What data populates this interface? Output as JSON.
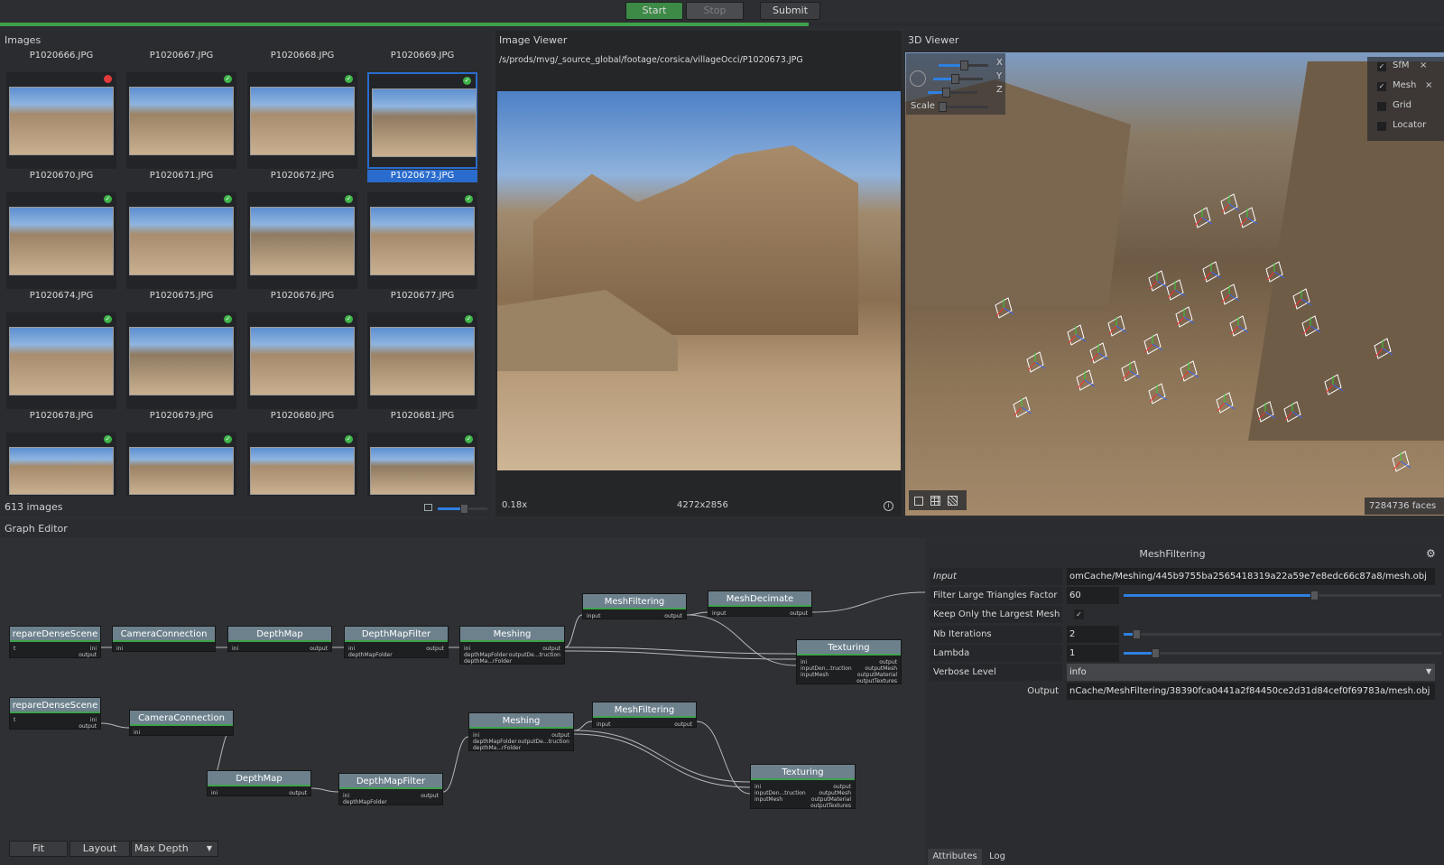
{
  "toolbar": {
    "start": "Start",
    "stop": "Stop",
    "submit": "Submit",
    "progress": 0.56
  },
  "images_panel": {
    "title": "Images",
    "count": "613 images",
    "zoom": 0.6,
    "header_labels": [
      "P1020666.JPG",
      "P1020667.JPG",
      "P1020668.JPG",
      "P1020669.JPG"
    ],
    "rows": [
      [
        "P1020670.JPG",
        "P1020671.JPG",
        "P1020672.JPG",
        "P1020673.JPG"
      ],
      [
        "P1020674.JPG",
        "P1020675.JPG",
        "P1020676.JPG",
        "P1020677.JPG"
      ],
      [
        "P1020678.JPG",
        "P1020679.JPG",
        "P1020680.JPG",
        "P1020681.JPG"
      ]
    ],
    "selected": "P1020673.JPG"
  },
  "image_viewer": {
    "title": "Image Viewer",
    "path": "/s/prods/mvg/_source_global/footage/corsica/villageOcci/P1020673.JPG",
    "zoom": "0.18x",
    "resolution": "4272x2856"
  },
  "viewer3d": {
    "title": "3D Viewer",
    "axes": [
      "X",
      "Y",
      "Z"
    ],
    "scale_label": "Scale",
    "layers": [
      "SfM",
      "Mesh",
      "Grid",
      "Locator"
    ],
    "layer_checked": [
      true,
      true,
      false,
      false
    ],
    "faces": "7284736 faces",
    "close_glyph": "×"
  },
  "graph": {
    "title": "Graph Editor",
    "row1": {
      "n1": "repareDenseScene",
      "n2": "CameraConnection",
      "n3": "DepthMap",
      "n4": "DepthMapFilter",
      "n5": "Meshing",
      "n6": "MeshFiltering",
      "n7": "MeshDecimate",
      "n8": "Texturing"
    },
    "row2": {
      "n1": "repareDenseScene",
      "n2": "CameraConnection",
      "n3": "DepthMap",
      "n4": "DepthMapFilter",
      "n5": "Meshing",
      "n6": "MeshFiltering",
      "n7": "Texturing"
    },
    "pins": {
      "ini": "ini",
      "input": "input",
      "output": "output",
      "inputMesh": "inputMesh",
      "depthMapFolder": "depthMapFolder",
      "depthMapsFilter": "depthMa...rFolder",
      "outputDense": "outputDe...truction",
      "inputDense": "inputDen...truction",
      "outputMesh": "outputMesh",
      "outputMaterial": "outputMaterial",
      "outputTextures": "outputTextures",
      "t": "t"
    },
    "fit": "Fit",
    "layout": "Layout",
    "depth": "Max Depth"
  },
  "attributes": {
    "node": "MeshFiltering",
    "input_label": "Input",
    "input_value": "omCache/Meshing/445b9755ba2565418319a22a59e7e8edc66c87a8/mesh.obj",
    "filter_label": "Filter Large Triangles Factor",
    "filter_value": "60",
    "filter_pct": 0.6,
    "keep_label": "Keep Only the Largest Mesh",
    "keep_check": "✓",
    "iter_label": "Nb Iterations",
    "iter_value": "2",
    "iter_pct": 0.04,
    "lambda_label": "Lambda",
    "lambda_value": "1",
    "lambda_pct": 0.1,
    "verbose_label": "Verbose Level",
    "verbose_value": "info",
    "output_label": "Output",
    "output_value": "nCache/MeshFiltering/38390fca0441a2f84450ce2d31d84cef0f69783a/mesh.obj",
    "tabs": [
      "Attributes",
      "Log"
    ]
  }
}
